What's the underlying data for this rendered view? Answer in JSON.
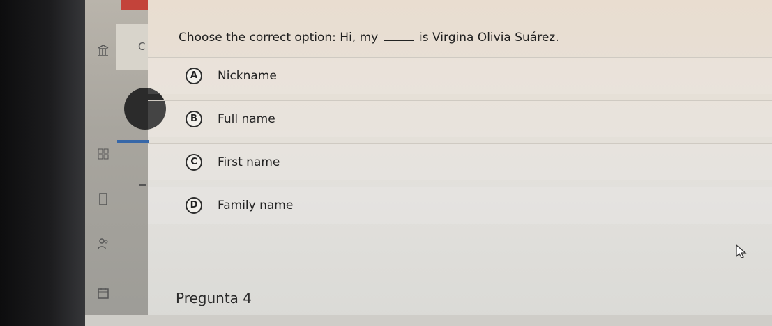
{
  "question": {
    "text_before": "Choose the correct option: Hi, my",
    "text_after": "is Virgina Olivia Suárez."
  },
  "options": [
    {
      "letter": "A",
      "label": "Nickname"
    },
    {
      "letter": "B",
      "label": "Full name"
    },
    {
      "letter": "C",
      "label": "First name"
    },
    {
      "letter": "D",
      "label": "Family name"
    }
  ],
  "next_question": {
    "title": "Pregunta 4"
  },
  "sidebar": {
    "tab_letter": "C"
  },
  "colors": {
    "accent_bar": "#3767a8",
    "header_strip": "#c3433a"
  }
}
